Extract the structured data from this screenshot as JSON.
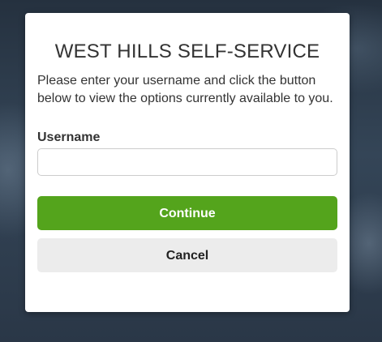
{
  "dialog": {
    "title": "WEST HILLS SELF-SERVICE",
    "intro": "Please enter your username and click the button below to view the options currently available to you.",
    "username_label": "Username",
    "username_value": "",
    "continue_label": "Continue",
    "cancel_label": "Cancel"
  },
  "colors": {
    "continue_button": "#54a41c",
    "cancel_button": "#ececec",
    "background": "#2f3d4e"
  }
}
